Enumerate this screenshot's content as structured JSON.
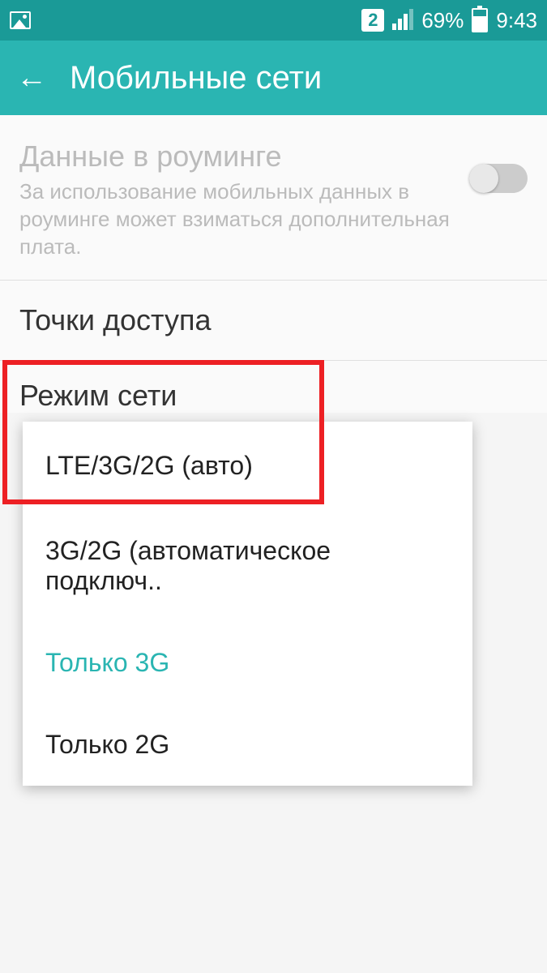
{
  "status_bar": {
    "sim_number": "2",
    "battery_percent": "69%",
    "time": "9:43"
  },
  "app_bar": {
    "title": "Мобильные сети"
  },
  "settings": {
    "roaming": {
      "title": "Данные в роуминге",
      "description": "За использование мобильных данных в роуминге может взиматься дополнительная плата.",
      "enabled": false
    },
    "access_points": {
      "title": "Точки доступа"
    },
    "network_mode": {
      "title": "Режим сети"
    }
  },
  "network_mode_popup": {
    "options": [
      {
        "label": "LTE/3G/2G (авто)",
        "selected": false
      },
      {
        "label": "3G/2G (автоматическое подключ..",
        "selected": false
      },
      {
        "label": "Только 3G",
        "selected": true
      },
      {
        "label": "Только 2G",
        "selected": false
      }
    ]
  }
}
